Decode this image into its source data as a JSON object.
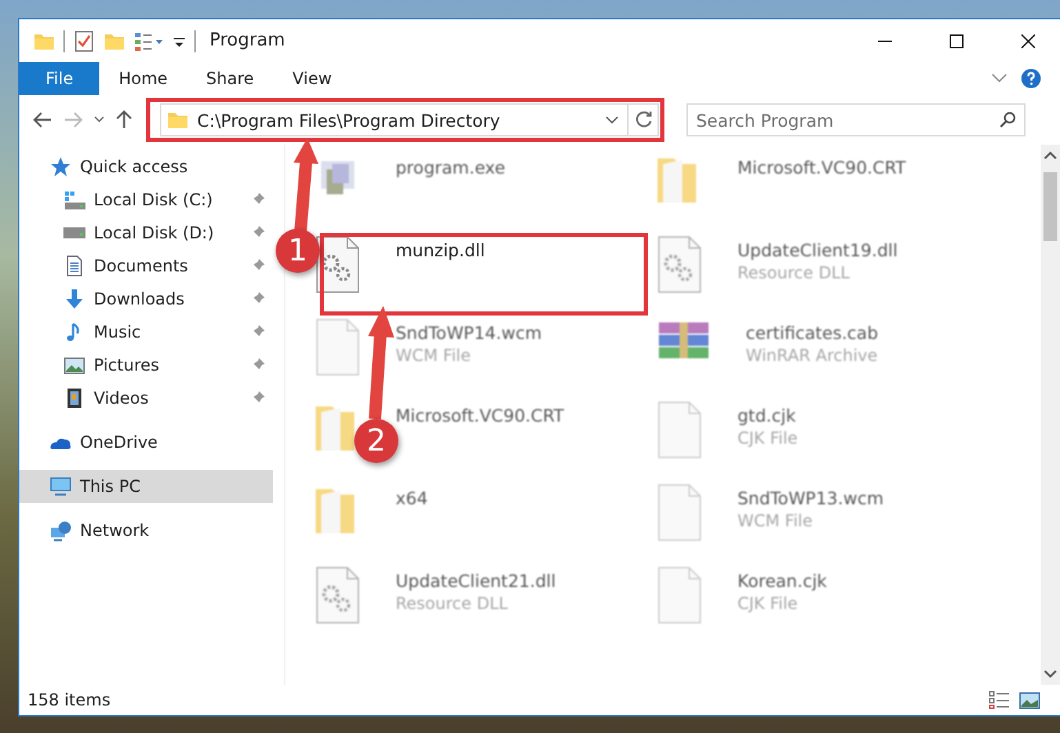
{
  "window": {
    "title": "Program"
  },
  "ribbon_tabs": [
    {
      "label": "File",
      "kind": "file"
    },
    {
      "label": "Home",
      "kind": "tab"
    },
    {
      "label": "Share",
      "kind": "tab"
    },
    {
      "label": "View",
      "kind": "tab"
    }
  ],
  "address": {
    "path": "C:\\Program Files\\Program Directory"
  },
  "search": {
    "placeholder": "Search Program"
  },
  "sidebar": {
    "items": [
      {
        "label": "Quick access",
        "selected": false,
        "children": [
          {
            "label": "Local Disk (C:)",
            "pinned": true,
            "selected": false
          },
          {
            "label": "Local Disk (D:)",
            "pinned": true,
            "selected": false
          },
          {
            "label": "Documents",
            "pinned": true,
            "selected": false
          },
          {
            "label": "Downloads",
            "pinned": true,
            "selected": false
          },
          {
            "label": "Music",
            "pinned": true,
            "selected": false
          },
          {
            "label": "Pictures",
            "pinned": true,
            "selected": false
          },
          {
            "label": "Videos",
            "pinned": true,
            "selected": false
          }
        ]
      },
      {
        "label": "OneDrive",
        "selected": false
      },
      {
        "label": "This PC",
        "selected": true
      },
      {
        "label": "Network",
        "selected": false
      }
    ]
  },
  "files": [
    {
      "name": "program.exe",
      "kind": "exe",
      "blurred": true
    },
    {
      "name": "Microsoft.VC90.CRT",
      "kind": "folder",
      "blurred": true
    },
    {
      "name": "munzip.dll",
      "kind": "dll",
      "blurred": false
    },
    {
      "name": "UpdateClient19.dll",
      "type": "Resource DLL",
      "kind": "dll",
      "blurred": true
    },
    {
      "name": "SndToWP14.wcm",
      "type": "WCM File",
      "kind": "file",
      "blurred": true
    },
    {
      "name": "certificates.cab",
      "type": "WinRAR Archive",
      "kind": "archive",
      "blurred": true
    },
    {
      "name": "Microsoft.VC90.CRT",
      "kind": "folder",
      "blurred": true
    },
    {
      "name": "gtd.cjk",
      "type": "CJK File",
      "kind": "file",
      "blurred": true
    },
    {
      "name": "x64",
      "kind": "folder",
      "blurred": true
    },
    {
      "name": "SndToWP13.wcm",
      "type": "WCM File",
      "kind": "file",
      "blurred": true
    },
    {
      "name": "UpdateClient21.dll",
      "type": "Resource DLL",
      "kind": "dll",
      "blurred": true
    },
    {
      "name": "Korean.cjk",
      "type": "CJK File",
      "kind": "file",
      "blurred": true
    }
  ],
  "status_bar": {
    "item_count": "158 items"
  },
  "annotations": [
    {
      "number": "1"
    },
    {
      "number": "2"
    }
  ]
}
